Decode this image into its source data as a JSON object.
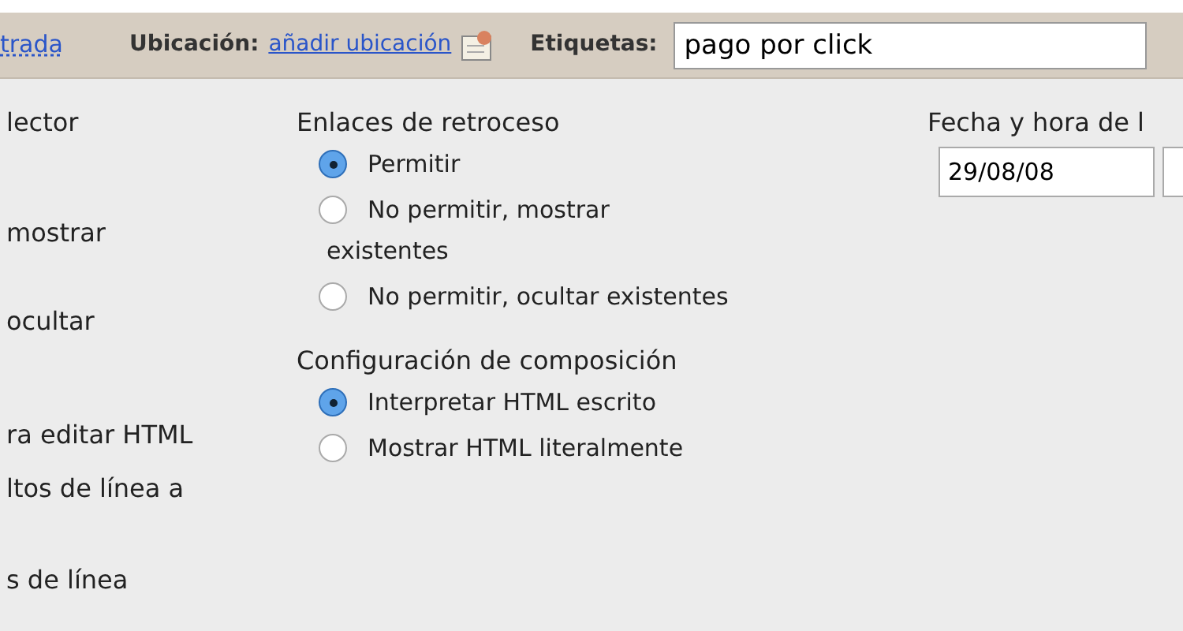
{
  "toolbar": {
    "link_partial": "trada",
    "location_label": "Ubicación:",
    "location_link": "añadir ubicación",
    "tags_label": "Etiquetas:",
    "tags_value": "pago por click"
  },
  "left_column": [
    "lector",
    "mostrar",
    "ocultar",
    "ra editar HTML",
    "ltos de línea a",
    "s de línea"
  ],
  "trackbacks": {
    "title": "Enlaces de retroceso",
    "options": [
      {
        "label": "Permitir",
        "selected": true
      },
      {
        "label": "No permitir, mostrar existentes",
        "selected": false
      },
      {
        "label": "No permitir, ocultar existentes",
        "selected": false
      }
    ]
  },
  "composition": {
    "title": "Configuración de composición",
    "options": [
      {
        "label": "Interpretar HTML escrito",
        "selected": true
      },
      {
        "label": "Mostrar HTML literalmente",
        "selected": false
      }
    ]
  },
  "timestamp": {
    "title": "Fecha y hora de l",
    "date": "29/08/08"
  }
}
